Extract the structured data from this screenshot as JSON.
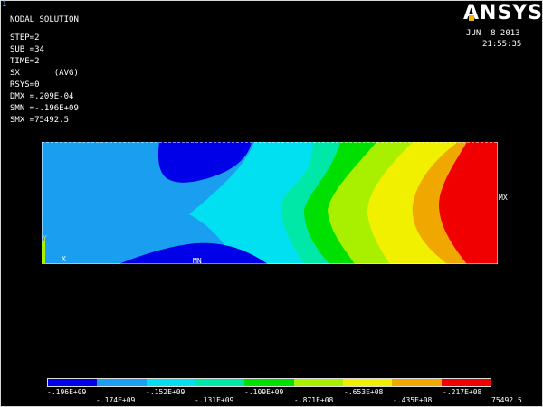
{
  "window": {
    "number": "1",
    "brand": "ANSYS"
  },
  "info": {
    "title": "NODAL SOLUTION",
    "lines": [
      "STEP=2",
      "SUB =34",
      "TIME=2",
      "SX       (AVG)",
      "RSYS=0",
      "DMX =.209E-04",
      "SMN =-.196E+09",
      "SMX =75492.5"
    ]
  },
  "datetime": {
    "date": "JUN  8 2013",
    "time": "21:55:35"
  },
  "plot_labels": {
    "mn": "MN",
    "mx": "MX",
    "y_axis": "Y",
    "x_axis": "X"
  },
  "legend": {
    "colors": [
      "#0000e8",
      "#1a9ff0",
      "#00e0f0",
      "#00e8a8",
      "#00e000",
      "#a8f000",
      "#f0f000",
      "#f0a800",
      "#f00000"
    ],
    "labels_top": [
      "-.196E+09",
      "-.152E+09",
      "-.109E+09",
      "-.653E+08",
      "-.217E+08"
    ],
    "labels_bottom": [
      "-.174E+09",
      "-.131E+09",
      "-.871E+08",
      "-.435E+08",
      "75492.5"
    ]
  },
  "colors": {
    "background": "#000000",
    "text": "#ffffff",
    "axis_y": "#ffd000"
  }
}
